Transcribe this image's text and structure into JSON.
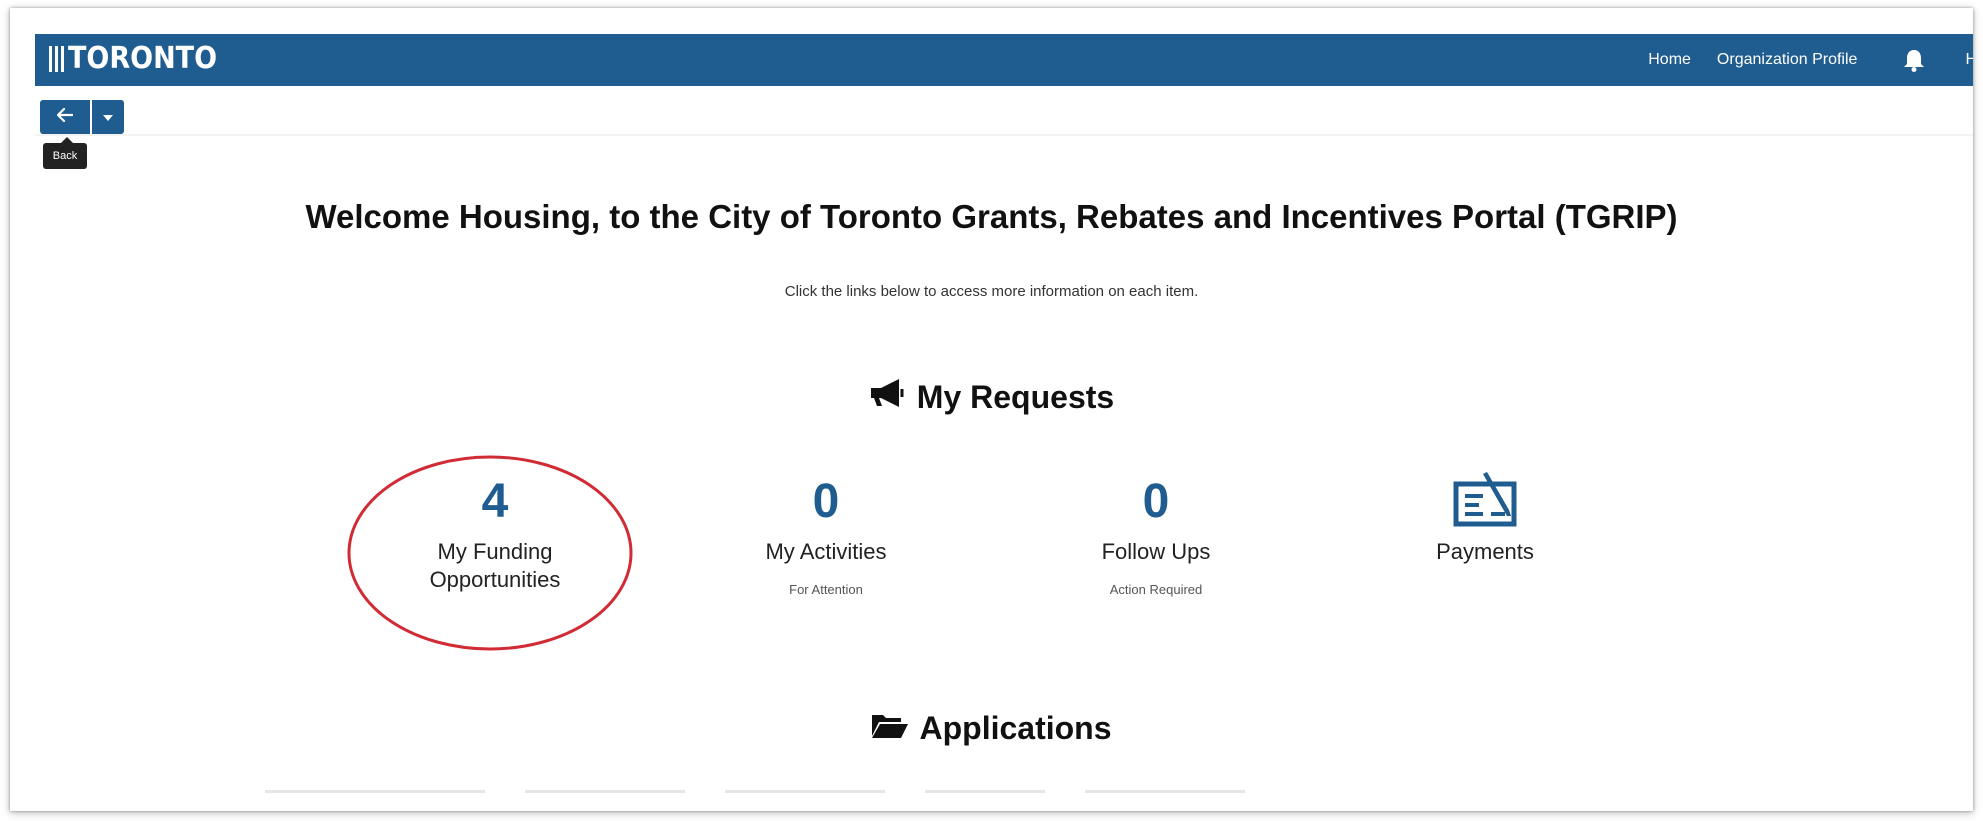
{
  "header": {
    "logo_text": "TORONTO",
    "nav": [
      "Home",
      "Organization Profile"
    ],
    "nav_truncated": "H"
  },
  "toolbar": {
    "back_icon": "arrow-left-icon",
    "caret_icon": "caret-down-icon",
    "back_tooltip": "Back"
  },
  "welcome": {
    "title": "Welcome Housing, to the City of Toronto Grants, Rebates and Incentives Portal (TGRIP)",
    "subtitle": "Click the links below to access more information on each item."
  },
  "my_requests": {
    "title": "My Requests",
    "icon": "megaphone-icon",
    "tiles": [
      {
        "count": "4",
        "label_line1": "My Funding",
        "label_line2": "Opportunities",
        "sub": ""
      },
      {
        "count": "0",
        "label_line1": "My Activities",
        "label_line2": "",
        "sub": "For Attention"
      },
      {
        "count": "0",
        "label_line1": "Follow Ups",
        "label_line2": "",
        "sub": "Action Required"
      },
      {
        "count": "",
        "label_line1": "Payments",
        "label_line2": "",
        "sub": "",
        "icon": "payment-icon"
      }
    ]
  },
  "applications": {
    "title": "Applications",
    "icon": "folder-open-icon"
  },
  "colors": {
    "brand": "#1f5c8f",
    "highlight_circle": "#d12b35"
  }
}
